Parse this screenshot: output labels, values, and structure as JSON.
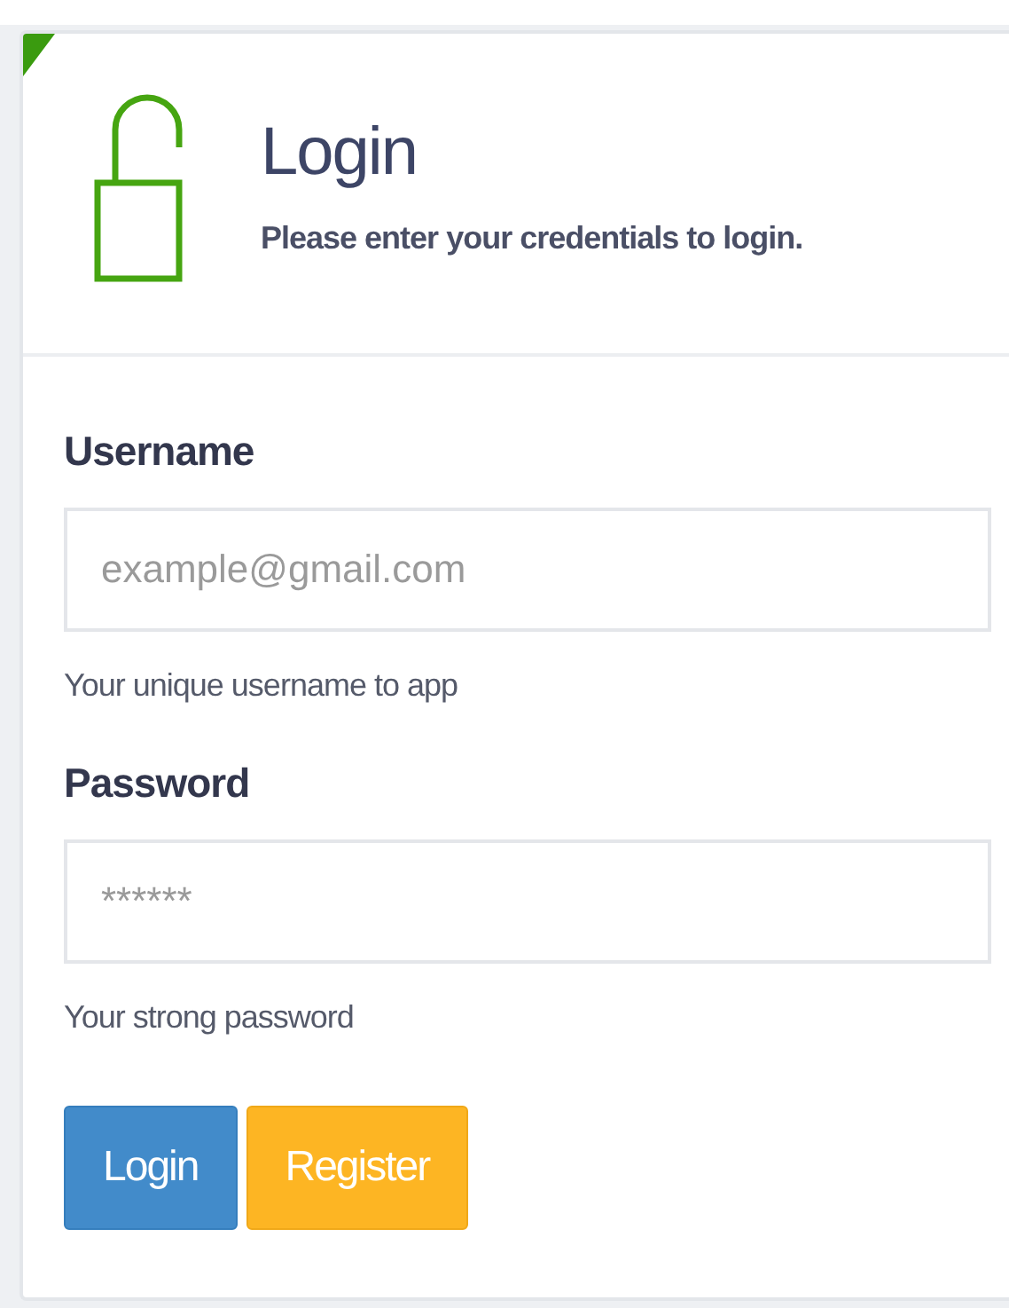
{
  "header": {
    "title": "Login",
    "subtitle": "Please enter your credentials to login."
  },
  "fields": [
    {
      "label": "Username",
      "placeholder": "example@gmail.com",
      "help": "Your unique username to app"
    },
    {
      "label": "Password",
      "placeholder": "******",
      "help": "Your strong password"
    }
  ],
  "buttons": [
    {
      "label": "Login",
      "kind": "primary"
    },
    {
      "label": "Register",
      "kind": "warning"
    }
  ]
}
